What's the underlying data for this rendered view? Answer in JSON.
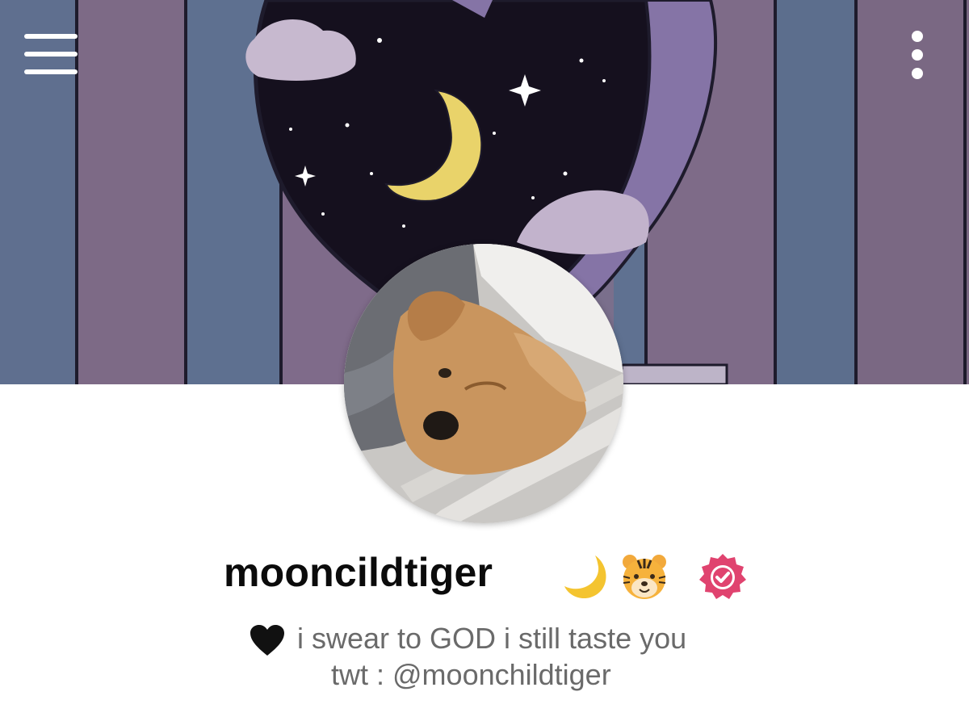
{
  "profile": {
    "username": "mooncildtiger",
    "bio_line1": "i swear to GOD i still taste you",
    "bio_line2": "twt : @moonchildtiger"
  },
  "icons": {
    "menu": "hamburger-menu-icon",
    "more": "vertical-dots-icon",
    "verified": "verified-badge-icon",
    "moon_emoji": "crescent-moon-emoji",
    "tiger_emoji": "tiger-face-emoji",
    "heart_emoji": "black-heart-emoji"
  },
  "colors": {
    "verified_badge": "#e0436f",
    "bio_text": "#6a6a6a",
    "username_text": "#0b0b0b"
  }
}
